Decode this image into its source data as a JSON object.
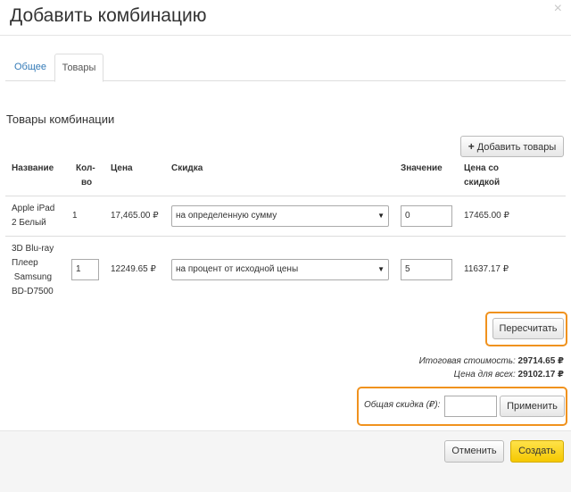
{
  "modal": {
    "title": "Добавить комбинацию",
    "close": "×"
  },
  "tabs": [
    {
      "label": "Общее",
      "active": false
    },
    {
      "label": "Товары",
      "active": true
    }
  ],
  "section": {
    "title": "Товары комбинации",
    "add_button": "Добавить товары",
    "add_icon": "plus-icon"
  },
  "table": {
    "headers": {
      "name": "Название",
      "qty_1": "Кол-",
      "qty_2": "во",
      "price": "Цена",
      "discount": "Скидка",
      "value": "Значение",
      "disc_price_1": "Цена со",
      "disc_price_2": "скидкой"
    },
    "rows": [
      {
        "name_lines": [
          "Apple iPad",
          "2 Белый"
        ],
        "qty": "1",
        "qty_editable": false,
        "price": "17,465.00 ₽",
        "discount_type": "на определенную сумму",
        "value": "0",
        "discounted_price": "17465.00 ₽"
      },
      {
        "name_lines": [
          "3D Blu-ray",
          "Плеер",
          " Samsung",
          "BD-D7500"
        ],
        "qty": "1",
        "qty_editable": true,
        "price": "12249.65 ₽",
        "discount_type": "на процент от исходной цены",
        "value": "5",
        "discounted_price": "11637.17 ₽"
      }
    ]
  },
  "recalc_button": "Пересчитать",
  "totals": {
    "total_label": "Итоговая стоимость:",
    "total_value": "29714.65 ₽",
    "all_label": "Цена для всех:",
    "all_value": "29102.17 ₽"
  },
  "general_discount": {
    "label": "Общая скидка (₽):",
    "value": "",
    "apply_button": "Применить"
  },
  "footer": {
    "cancel_button": "Отменить",
    "create_button": "Создать"
  },
  "colors": {
    "highlight": "#f0921e",
    "link": "#337ab7",
    "primary_button": "#f5c800"
  }
}
